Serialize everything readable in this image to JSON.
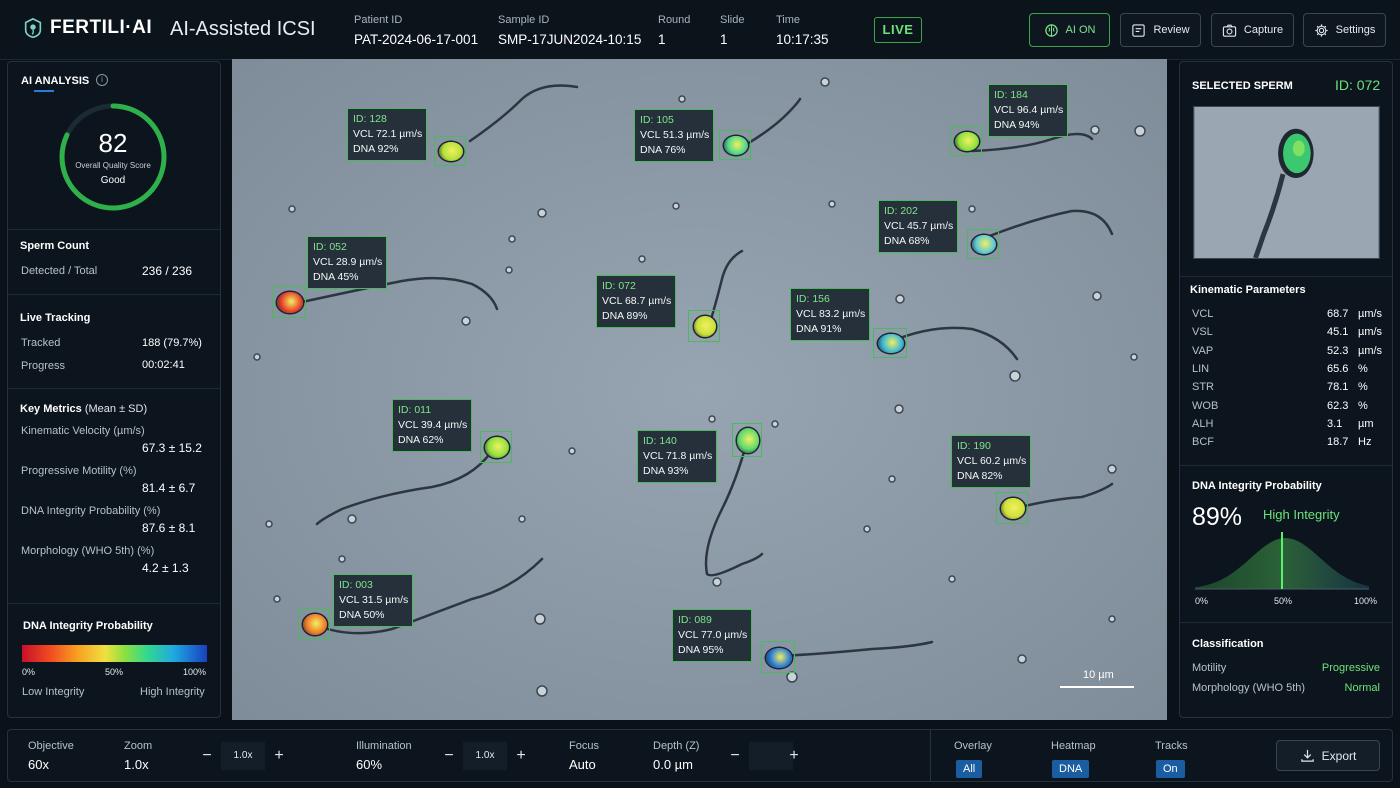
{
  "header": {
    "brand": "FERTILI·AI",
    "app_title": "AI-Assisted ICSI",
    "patient_id_label": "Patient ID",
    "patient_id": "PAT-2024-06-17-001",
    "sample_id_label": "Sample ID",
    "sample_id": "SMP-17JUN2024-10:15",
    "round_label": "Round",
    "round": "1",
    "slide_label": "Slide",
    "slide": "1",
    "time_label": "Time",
    "time": "10:17:35",
    "live": "LIVE",
    "buttons": {
      "ai": "AI ON",
      "review": "Review",
      "capture": "Capture",
      "settings": "Settings"
    }
  },
  "left": {
    "ai_analysis": "AI ANALYSIS",
    "score": "82",
    "score_label": "Overall Quality Score",
    "score_status": "Good",
    "score_fraction": 0.82,
    "sperm_count_title": "Sperm Count",
    "detected_label": "Detected / Total",
    "detected_value": "236  /  236",
    "live_tracking_title": "Live Tracking",
    "tracked_label": "Tracked",
    "tracked_value": "188 (79.7%)",
    "progress_label": "Progress",
    "progress_value": "00:02:41",
    "key_metrics_title": "Key Metrics",
    "key_metrics_sub": "(Mean ± SD)",
    "metrics": [
      {
        "label": "Kinematic Velocity (µm/s)",
        "value": "67.3  ±  15.2"
      },
      {
        "label": "Progressive Motility (%)",
        "value": "81.4  ±  6.7"
      },
      {
        "label": "DNA Integrity Probability (%)",
        "value": "87.6  ±  8.1"
      },
      {
        "label": "Morphology (WHO 5th) (%)",
        "value": "4.2  ±  1.3"
      }
    ],
    "dna_title": "DNA Integrity Probability",
    "scale_ticks": [
      "0%",
      "50%",
      "100%"
    ],
    "low": "Low Integrity",
    "high": "High Integrity"
  },
  "center": {
    "scale_bar": "10 µm",
    "sperm": [
      {
        "id": "ID: 128",
        "vcl": "VCL  72.1 µm/s",
        "dna": "DNA  92%",
        "color": "#b4e03a"
      },
      {
        "id": "ID: 105",
        "vcl": "VCL  51.3 µm/s",
        "dna": "DNA  76%",
        "color": "#4fd88a"
      },
      {
        "id": "ID: 184",
        "vcl": "VCL  96.4 µm/s",
        "dna": "DNA  94%",
        "color": "#8fe040"
      },
      {
        "id": "ID: 202",
        "vcl": "VCL  45.7 µm/s",
        "dna": "DNA  68%",
        "color": "#5fc8d8"
      },
      {
        "id": "ID: 052",
        "vcl": "VCL  28.9 µm/s",
        "dna": "DNA  45%",
        "color": "#e8402a"
      },
      {
        "id": "ID: 072",
        "vcl": "VCL  68.7 µm/s",
        "dna": "DNA  89%",
        "color": "#c8e03a"
      },
      {
        "id": "ID: 156",
        "vcl": "VCL  83.2 µm/s",
        "dna": "DNA  91%",
        "color": "#3ab8d8"
      },
      {
        "id": "ID: 011",
        "vcl": "VCL  39.4 µm/s",
        "dna": "DNA  62%",
        "color": "#8ee040"
      },
      {
        "id": "ID: 140",
        "vcl": "VCL  71.8 µm/s",
        "dna": "DNA  93%",
        "color": "#5fd870"
      },
      {
        "id": "ID: 190",
        "vcl": "VCL  60.2 µm/s",
        "dna": "DNA  82%",
        "color": "#d0e03a"
      },
      {
        "id": "ID: 003",
        "vcl": "VCL  31.5 µm/s",
        "dna": "DNA  50%",
        "color": "#f07a2a"
      },
      {
        "id": "ID: 089",
        "vcl": "VCL  77.0 µm/s",
        "dna": "DNA  95%",
        "color": "#2a7ad8"
      }
    ]
  },
  "right": {
    "selected_title": "SELECTED SPERM",
    "selected_id": "ID: 072",
    "kinematic_title": "Kinematic Parameters",
    "params": [
      {
        "k": "VCL",
        "v": "68.7",
        "u": "µm/s"
      },
      {
        "k": "VSL",
        "v": "45.1",
        "u": "µm/s"
      },
      {
        "k": "VAP",
        "v": "52.3",
        "u": "µm/s"
      },
      {
        "k": "LIN",
        "v": "65.6",
        "u": "%"
      },
      {
        "k": "STR",
        "v": "78.1",
        "u": "%"
      },
      {
        "k": "WOB",
        "v": "62.3",
        "u": "%"
      },
      {
        "k": "ALH",
        "v": "3.1",
        "u": "µm"
      },
      {
        "k": "BCF",
        "v": "18.7",
        "u": "Hz"
      }
    ],
    "dna_title": "DNA Integrity Probability",
    "dna_value": "89%",
    "dna_status": "High Integrity",
    "dna_fraction": 0.89,
    "axis": [
      "0%",
      "50%",
      "100%"
    ],
    "classification_title": "Classification",
    "motility_label": "Motility",
    "motility_value": "Progressive",
    "morph_label": "Morphology (WHO 5th)",
    "morph_value": "Normal"
  },
  "bottom": {
    "objective_label": "Objective",
    "objective": "60x",
    "zoom_label": "Zoom",
    "zoom": "1.0x",
    "zoom_step": "1.0x",
    "illum_label": "Illumination",
    "illum": "60%",
    "illum_step": "1.0x",
    "focus_label": "Focus",
    "focus": "Auto",
    "depth_label": "Depth (Z)",
    "depth": "0.0 µm",
    "overlay_label": "Overlay",
    "overlay": "All",
    "heatmap_label": "Heatmap",
    "heatmap": "DNA",
    "tracks_label": "Tracks",
    "tracks": "On",
    "export": "Export"
  },
  "colors": {
    "accent": "#4cb95c",
    "panel": "#0c151e",
    "select": "#1b5da1"
  }
}
